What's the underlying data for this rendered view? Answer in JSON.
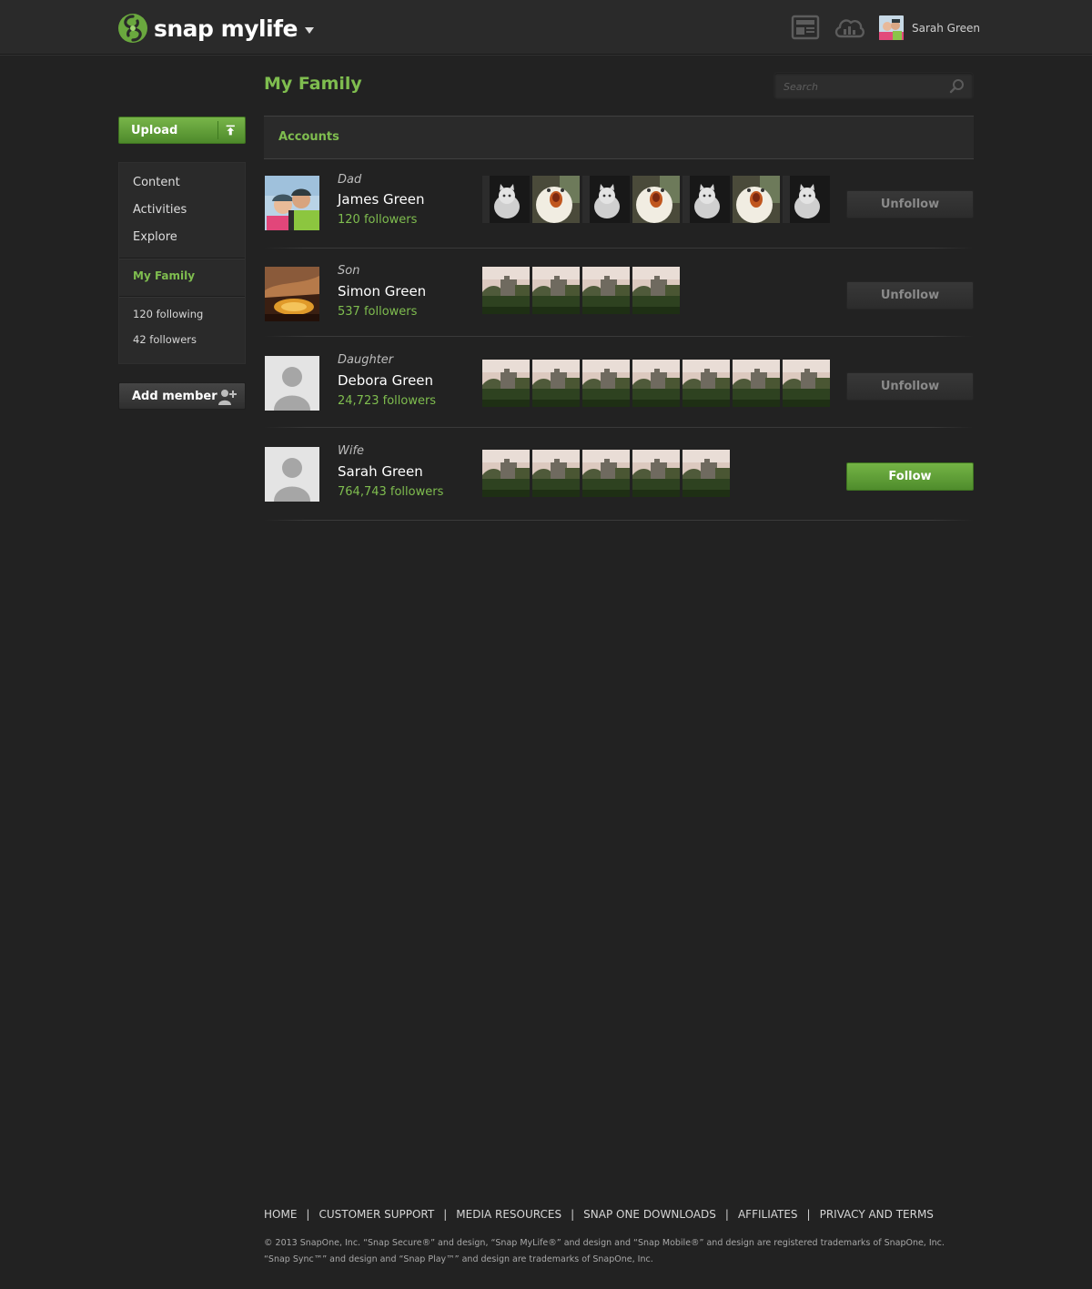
{
  "header": {
    "brand": "snap mylife",
    "user_name": "Sarah Green",
    "icons": [
      "snap-logo-icon",
      "news-icon",
      "cloud-icon",
      "dropdown-caret-icon"
    ]
  },
  "sidebar": {
    "upload_label": "Upload",
    "nav": [
      {
        "label": "Content"
      },
      {
        "label": "Activities"
      },
      {
        "label": "Explore"
      },
      {
        "label": "My Family",
        "active": true
      }
    ],
    "stats": {
      "following": "120 following",
      "followers": "42 followers"
    },
    "add_member_label": "Add member"
  },
  "main": {
    "title": "My Family",
    "search_placeholder": "Search",
    "section_label": "Accounts",
    "members": [
      {
        "relation": "Dad",
        "name": "James Green",
        "followers": "120 followers",
        "action": "Unfollow",
        "photo_count": 7
      },
      {
        "relation": "Son",
        "name": "Simon Green",
        "followers": "537 followers",
        "action": "Unfollow",
        "photo_count": 4
      },
      {
        "relation": "Daughter",
        "name": "Debora Green",
        "followers": "24,723 followers",
        "action": "Unfollow",
        "photo_count": 7
      },
      {
        "relation": "Wife",
        "name": "Sarah Green",
        "followers": "764,743 followers",
        "action": "Follow",
        "photo_count": 5
      }
    ]
  },
  "footer": {
    "links": [
      "HOME",
      "CUSTOMER SUPPORT",
      "MEDIA RESOURCES",
      "SNAP ONE DOWNLOADS",
      "AFFILIATES",
      "PRIVACY AND TERMS"
    ],
    "separator": "|",
    "copyright_line1": "© 2013 SnapOne, Inc.  “Snap Secure®” and design, “Snap MyLife®” and design and “Snap Mobile®” and design are registered trademarks of SnapOne, Inc.",
    "copyright_line2": "“Snap Sync™” and design and “Snap Play™” and design are trademarks of SnapOne, Inc."
  },
  "colors": {
    "accent_green": "#7fbd4f",
    "background": "#222222",
    "topbar": "#2a2a2a"
  }
}
